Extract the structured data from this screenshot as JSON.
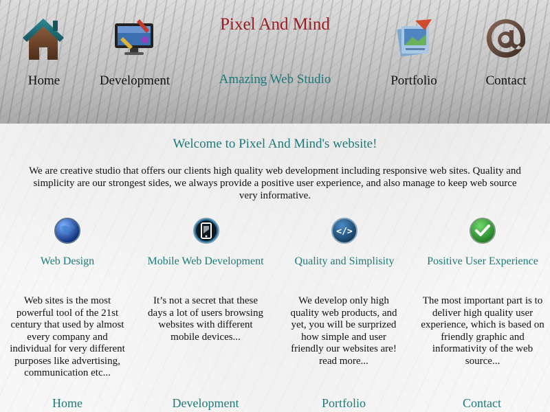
{
  "site": {
    "title": "Pixel And Mind",
    "tagline": "Amazing Web Studio"
  },
  "nav": [
    {
      "label": "Home",
      "icon": "house-icon"
    },
    {
      "label": "Development",
      "icon": "monitor-tools-icon"
    },
    {
      "label": "Portfolio",
      "icon": "documents-icon"
    },
    {
      "label": "Contact",
      "icon": "at-sign-icon"
    }
  ],
  "welcome": "Welcome to Pixel And Mind's website!",
  "intro": "We are creative studio that offers our clients high quality web development including responsive web sites. Quality and simplicity are our strongest sides, we always provide a positive user experience, and also manage to keep web source very informative.",
  "features": [
    {
      "title": "Web Design",
      "icon": "globe-icon",
      "text": "Web sites is the most powerful tool of the 21st century that used by almost every company and individual for very different purposes like advertising, communication etc..."
    },
    {
      "title": "Mobile Web Development",
      "icon": "mobile-phone-icon",
      "text": "It’s not a secret that these days a lot of users browsing websites with different mobile devices..."
    },
    {
      "title": "Quality and Simplisity",
      "icon": "code-icon",
      "text": "We develop only high quality web products, and yet, you will be surprized how simple and user friendly our websites are! read more..."
    },
    {
      "title": "Positive User Experience",
      "icon": "checkmark-icon",
      "text": "The most important part is to deliver high quality user experience, which is based on friendly graphic and informativity of the web source..."
    }
  ],
  "footer": [
    {
      "label": "Home"
    },
    {
      "label": "Development"
    },
    {
      "label": "Portfolio"
    },
    {
      "label": "Contact"
    }
  ],
  "colors": {
    "title": "#9b1c20",
    "accent": "#1c7a78"
  }
}
